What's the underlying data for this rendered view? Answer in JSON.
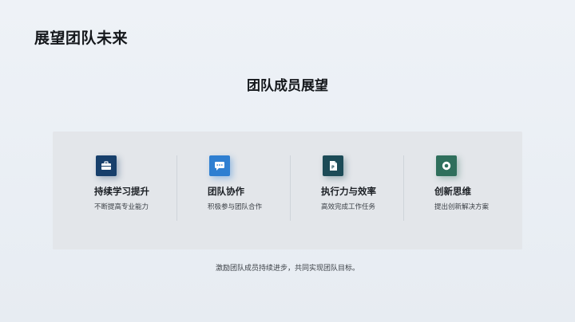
{
  "slide": {
    "title": "展望团队未来",
    "section_title": "团队成员展望",
    "footer_note": "激励团队成员持续进步，共同实现团队目标。"
  },
  "cards": [
    {
      "title": "持续学习提升",
      "description": "不断提高专业能力",
      "icon": "briefcase-icon",
      "color": "#173f6b"
    },
    {
      "title": "团队协作",
      "description": "积极参与团队合作",
      "icon": "chat-icon",
      "color": "#2f7fd1"
    },
    {
      "title": "执行力与效率",
      "description": "高效完成工作任务",
      "icon": "document-icon",
      "color": "#1c4b57"
    },
    {
      "title": "创新思维",
      "description": "提出创新解决方案",
      "icon": "target-icon",
      "color": "#2f6f5c"
    }
  ]
}
